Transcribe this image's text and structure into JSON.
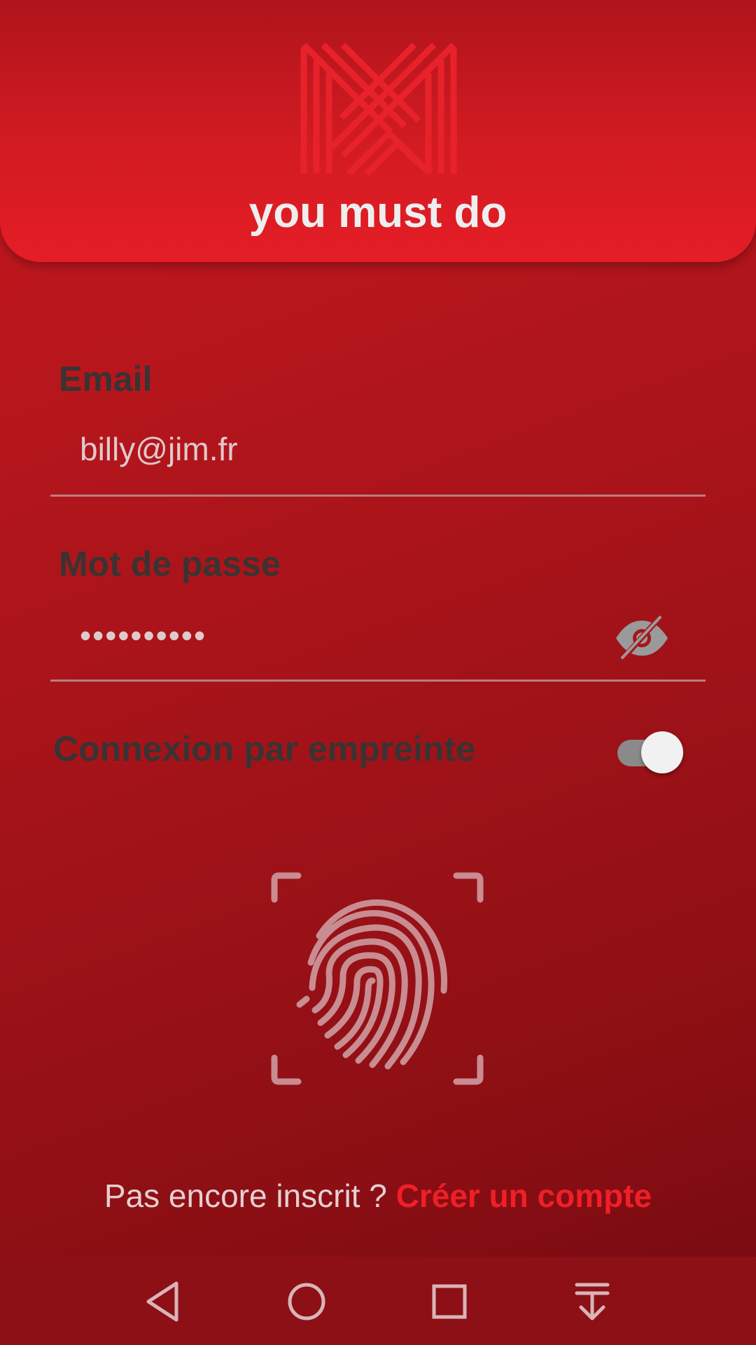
{
  "header": {
    "app_title": "you must do",
    "logo_icon": "m-monogram-logo"
  },
  "form": {
    "email": {
      "label": "Email",
      "value": "billy@jim.fr"
    },
    "password": {
      "label": "Mot de passe",
      "value": "••••••••••",
      "visibility_icon": "eye-off-icon"
    },
    "fingerprint_login": {
      "label": "Connexion par empreinte",
      "enabled": true
    },
    "fingerprint_icon": "fingerprint-scan-icon"
  },
  "signup": {
    "prompt": "Pas encore inscrit ?",
    "link": "Créer un compte"
  },
  "navbar": {
    "items": [
      "back-icon",
      "home-icon",
      "recents-icon",
      "notifications-pull-icon"
    ]
  },
  "colors": {
    "accent": "#ef1f28",
    "background_top": "#c8181f",
    "background_bottom": "#730a10",
    "header": "#e51d26",
    "label": "#3a3333"
  }
}
